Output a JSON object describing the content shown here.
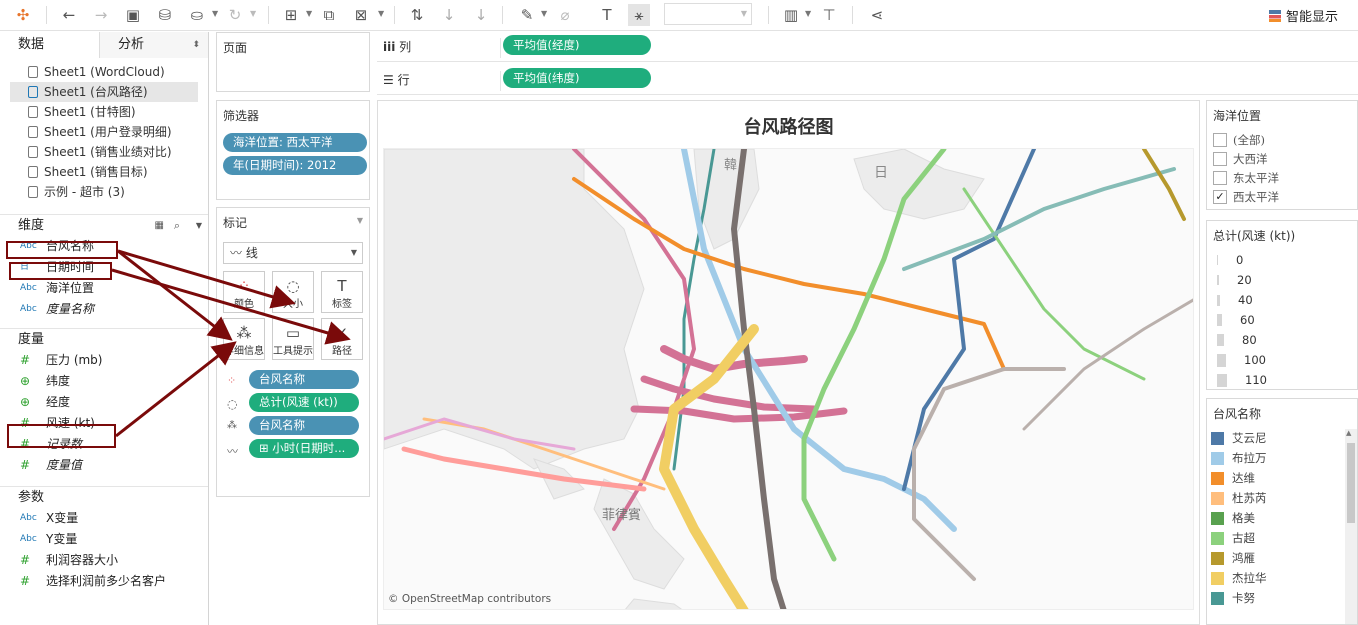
{
  "toolbar": {
    "smart_label": "智能显示",
    "icons": [
      "tableau-logo-icon",
      "undo-icon",
      "redo-icon",
      "save-icon",
      "new-datasource-icon",
      "pause-icon",
      "refresh-icon",
      "new-worksheet-icon",
      "duplicate-icon",
      "clear-icon",
      "swap-icon",
      "sort-asc-icon",
      "sort-desc-icon",
      "highlight-icon",
      "group-icon",
      "label-icon",
      "fix-axes-icon",
      "fit-select",
      "chart-icon",
      "presentation-icon",
      "share-icon"
    ]
  },
  "left": {
    "tab_data": "数据",
    "tab_analysis": "分析",
    "sheets": [
      "Sheet1 (WordCloud)",
      "Sheet1 (台风路径)",
      "Sheet1 (甘特图)",
      "Sheet1 (用户登录明细)",
      "Sheet1 (销售业绩对比)",
      "Sheet1 (销售目标)",
      "示例 - 超市 (3)"
    ],
    "dimensions_label": "维度",
    "dimensions": [
      {
        "icon": "Abc",
        "label": "台风名称"
      },
      {
        "icon": "日",
        "label": "日期时间"
      },
      {
        "icon": "Abc",
        "label": "海洋位置"
      },
      {
        "icon": "Abc",
        "label": "度量名称"
      }
    ],
    "measures_label": "度量",
    "measures": [
      {
        "icon": "#",
        "label": "压力 (mb)"
      },
      {
        "icon": "⊕",
        "label": "纬度"
      },
      {
        "icon": "⊕",
        "label": "经度"
      },
      {
        "icon": "#",
        "label": "风速 (kt)"
      },
      {
        "icon": "#",
        "label": "记录数"
      },
      {
        "icon": "#",
        "label": "度量值"
      }
    ],
    "params_label": "参数",
    "params": [
      {
        "icon": "Abc",
        "label": "X变量"
      },
      {
        "icon": "Abc",
        "label": "Y变量"
      },
      {
        "icon": "#",
        "label": "利润容器大小"
      },
      {
        "icon": "#",
        "label": "选择利润前多少名客户"
      }
    ]
  },
  "mid": {
    "pages_label": "页面",
    "filters_label": "筛选器",
    "filters": [
      "海洋位置: 西太平洋",
      "年(日期时间): 2012"
    ],
    "marks_label": "标记",
    "mark_type": "线",
    "mark_buttons": [
      "颜色",
      "大小",
      "标签",
      "详细信息",
      "工具提示",
      "路径"
    ],
    "mark_pills": [
      "台风名称",
      "总计(风速 (kt))",
      "台风名称",
      "小时(日期时..."
    ]
  },
  "shelves": {
    "columns_label": "列",
    "columns_pill": "平均值(经度)",
    "rows_label": "行",
    "rows_pill": "平均值(纬度)"
  },
  "viz": {
    "title": "台风路径图",
    "map_labels": [
      "韓",
      "日",
      "菲律賓"
    ],
    "credit": "© OpenStreetMap contributors"
  },
  "right": {
    "ocean_title": "海洋位置",
    "ocean_items": [
      {
        "label": "(全部)",
        "checked": false
      },
      {
        "label": "大西洋",
        "checked": false
      },
      {
        "label": "东太平洋",
        "checked": false
      },
      {
        "label": "西太平洋",
        "checked": true
      }
    ],
    "size_title": "总计(风速 (kt))",
    "size_values": [
      "0",
      "20",
      "40",
      "60",
      "80",
      "100",
      "110"
    ],
    "color_title": "台风名称",
    "legend": [
      {
        "label": "艾云尼",
        "color": "#4e79a7"
      },
      {
        "label": "布拉万",
        "color": "#a0cbe8"
      },
      {
        "label": "达维",
        "color": "#f28e2b"
      },
      {
        "label": "杜苏芮",
        "color": "#ffbe7d"
      },
      {
        "label": "格美",
        "color": "#59a14f"
      },
      {
        "label": "古超",
        "color": "#8cd17d"
      },
      {
        "label": "鸿雁",
        "color": "#b6992d"
      },
      {
        "label": "杰拉华",
        "color": "#f1ce63"
      },
      {
        "label": "卡努",
        "color": "#499894"
      }
    ]
  }
}
